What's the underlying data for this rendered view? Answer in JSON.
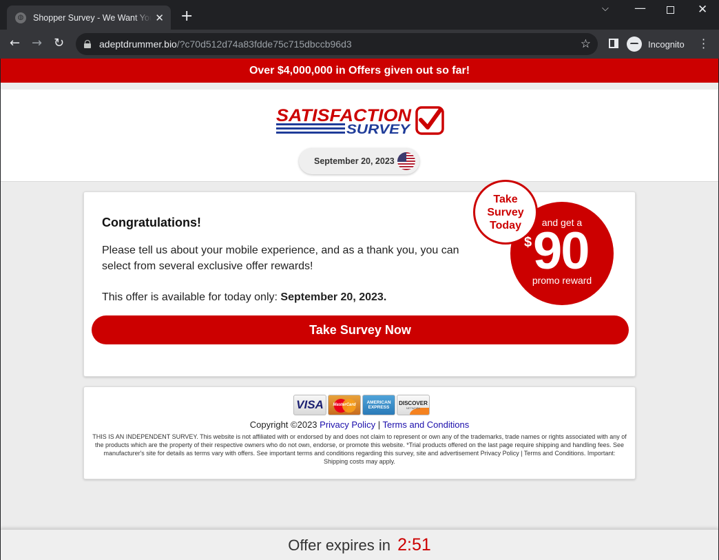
{
  "browser": {
    "tab_title": "Shopper Survey - We Want Your",
    "tab_close": "✕",
    "new_tab": "+",
    "url_host": "adeptdrummer.bio",
    "url_path": "/?c70d512d74a83fdde75c715dbccb96d3",
    "incognito_label": "Incognito",
    "icons": [
      "globe-icon",
      "back-arrow-icon",
      "forward-arrow-icon",
      "reload-icon",
      "lock-icon",
      "star-icon",
      "side-panel-icon",
      "incognito-icon",
      "kebab-menu-icon"
    ]
  },
  "banner": {
    "text": "Over $4,000,000 in Offers given out so far!"
  },
  "header": {
    "logo_line1": "SATISFACTION",
    "logo_line2": "SURVEY",
    "date": "September 20, 2023"
  },
  "main_card": {
    "heading": "Congratulations!",
    "intro": "Please tell us about your mobile experience, and as a thank you, you can select from several exclusive offer rewards!",
    "availability_prefix": "This offer is available for today only: ",
    "availability_date": "September 20, 2023.",
    "cta_label": "Take Survey Now",
    "badge_small": [
      "Take",
      "Survey",
      "Today"
    ],
    "badge_big": {
      "top": "and get a",
      "currency": "$",
      "amount": "90",
      "bottom": "promo reward"
    }
  },
  "footer": {
    "payment_cards": {
      "visa": "VISA",
      "mastercard": "MasterCard",
      "amex_line1": "AMERICAN",
      "amex_line2": "EXPRESS",
      "discover": "DISCOVER",
      "discover_sub": "NETWORK"
    },
    "copyright": "Copyright ©2023",
    "privacy_link": "Privacy Policy",
    "separator": "|",
    "terms_link": "Terms and Conditions",
    "disclaimer": "THIS IS AN INDEPENDENT SURVEY. This website is not affiliated with or endorsed by and does not claim to represent or own any of the trademarks, trade names or rights associated with any of the products which are the property of their respective owners who do not own, endorse, or promote this website. *Trial products offered on the last page require shipping and handling fees. See manufacturer's site for details as terms vary with offers. See important terms and conditions regarding this survey, site and advertisement Privacy Policy | Terms and Conditions. Important: Shipping costs may apply."
  },
  "expiry": {
    "label": "Offer expires in",
    "timer": "2:51"
  },
  "colors": {
    "brand_red": "#cc0000",
    "logo_blue": "#1f3c99",
    "chrome_dark": "#202124",
    "chrome_toolbar": "#35363a"
  }
}
